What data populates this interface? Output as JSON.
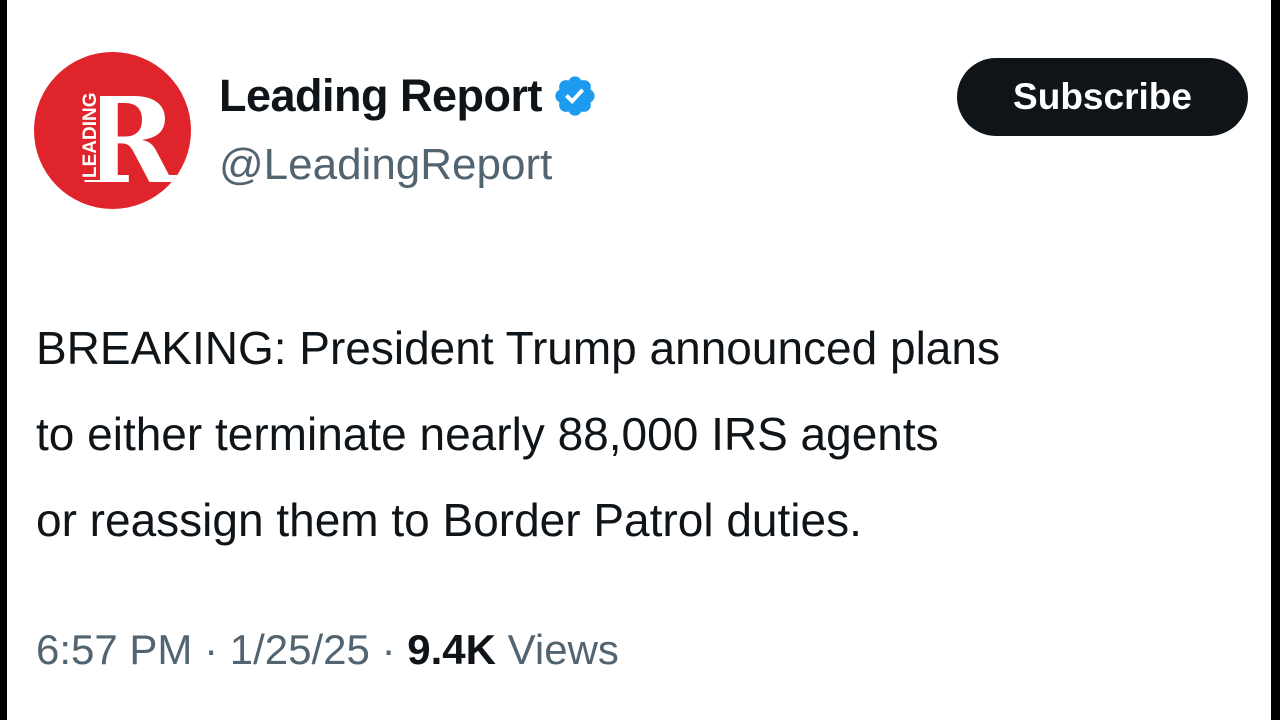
{
  "author": {
    "display_name": "Leading Report",
    "handle": "@LeadingReport",
    "avatar_letter": "R",
    "avatar_small_text": "LEADING",
    "avatar_color": "#e0242b",
    "verified": true,
    "verified_icon": "verified-badge-icon",
    "verified_color": "#1d9bf0"
  },
  "actions": {
    "subscribe_label": "Subscribe"
  },
  "tweet": {
    "lines": [
      "BREAKING: President Trump announced plans",
      "to either terminate nearly 88,000 IRS agents",
      "or reassign them to Border Patrol duties."
    ],
    "time": "6:57 PM",
    "date": "1/25/25",
    "views_count": "9.4K",
    "views_label": "Views",
    "separator": "·"
  }
}
